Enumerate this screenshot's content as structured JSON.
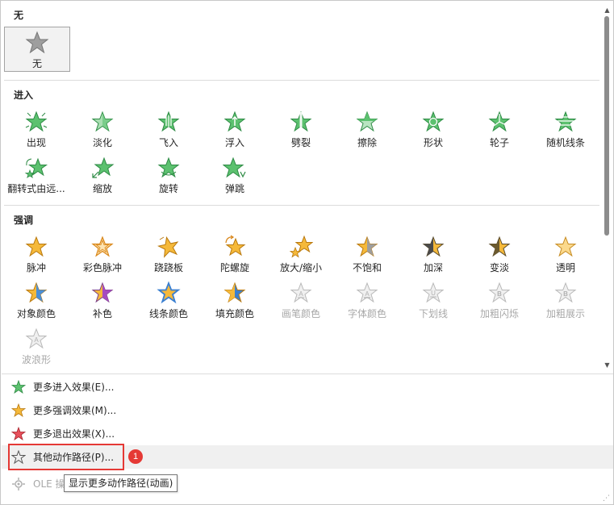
{
  "sections": {
    "none": "无",
    "entrance": "进入",
    "emphasis": "强调"
  },
  "none_items": [
    {
      "label": "无"
    }
  ],
  "entrance_items": [
    {
      "label": "出现"
    },
    {
      "label": "淡化"
    },
    {
      "label": "飞入"
    },
    {
      "label": "浮入"
    },
    {
      "label": "劈裂"
    },
    {
      "label": "擦除"
    },
    {
      "label": "形状"
    },
    {
      "label": "轮子"
    },
    {
      "label": "随机线条"
    },
    {
      "label": "翻转式由远..."
    },
    {
      "label": "缩放"
    },
    {
      "label": "旋转"
    },
    {
      "label": "弹跳"
    }
  ],
  "emphasis_items": [
    {
      "label": "脉冲"
    },
    {
      "label": "彩色脉冲"
    },
    {
      "label": "跷跷板"
    },
    {
      "label": "陀螺旋"
    },
    {
      "label": "放大/缩小"
    },
    {
      "label": "不饱和"
    },
    {
      "label": "加深"
    },
    {
      "label": "变淡"
    },
    {
      "label": "透明"
    },
    {
      "label": "对象颜色"
    },
    {
      "label": "补色"
    },
    {
      "label": "线条颜色"
    },
    {
      "label": "填充颜色"
    },
    {
      "label": "画笔颜色"
    },
    {
      "label": "字体颜色"
    },
    {
      "label": "下划线"
    },
    {
      "label": "加粗闪烁"
    },
    {
      "label": "加粗展示"
    },
    {
      "label": "波浪形"
    }
  ],
  "menu": {
    "more_entrance": "更多进入效果(E)...",
    "more_emphasis": "更多强调效果(M)...",
    "more_exit": "更多退出效果(X)...",
    "other_paths": "其他动作路径(P)...",
    "ole": "OLE 操"
  },
  "badge": "1",
  "tooltip": "显示更多动作路径(动画)",
  "colors": {
    "entrance_star": "#5cc16f",
    "emphasis_star": "#f5b93a",
    "exit_star": "#e8505b",
    "highlight": "#e53935"
  }
}
